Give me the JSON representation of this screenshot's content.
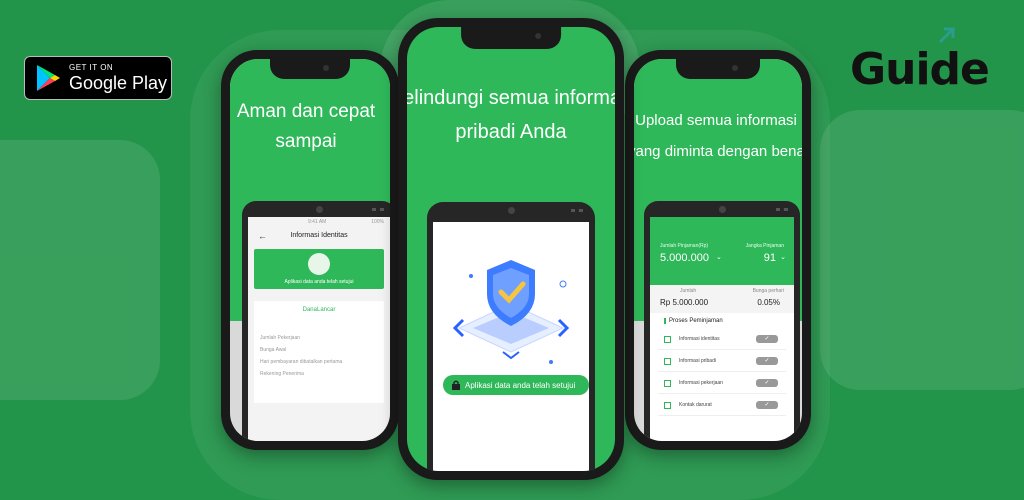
{
  "badge": {
    "small": "GET IT ON",
    "big": "Google Play"
  },
  "brand": {
    "text": "Guide",
    "accent": "#2fb85a"
  },
  "left_phone": {
    "headline_1": "Aman dan cepat",
    "headline_2": "sampai",
    "status_time": "9:41 AM",
    "status_battery": "100%",
    "title": "Informasi Identitas",
    "approved": "Aplikasi data anda telah setujui",
    "app_name": "DanaLancar",
    "fields": [
      "Jumlah Pekerjaan",
      "Bunga Awal",
      "Hari pembayaran dibatalkan pertama",
      "Rekening Penerima"
    ]
  },
  "center_phone": {
    "headline_1": "Melindungi semua informasi",
    "headline_2": "pribadi Anda",
    "button": "Aplikasi data anda telah setujui"
  },
  "right_phone": {
    "headline_1": "Upload semua informasi",
    "headline_2": "yang diminta dengan benar",
    "amount_label": "Jumlah Pinjaman(Rp)",
    "amount": "5.000.000",
    "term_label": "Jangka Pinjaman",
    "term": "91",
    "sum_label": "Jumlah",
    "sum": "Rp 5.000.000",
    "rate_label": "Bunga perhari",
    "rate": "0.05%",
    "process_title": "Proses Peminjaman",
    "process": [
      "Informasi identitas",
      "Informasi pribadi",
      "Informasi pekerjaan",
      "Kontak darurat"
    ]
  }
}
